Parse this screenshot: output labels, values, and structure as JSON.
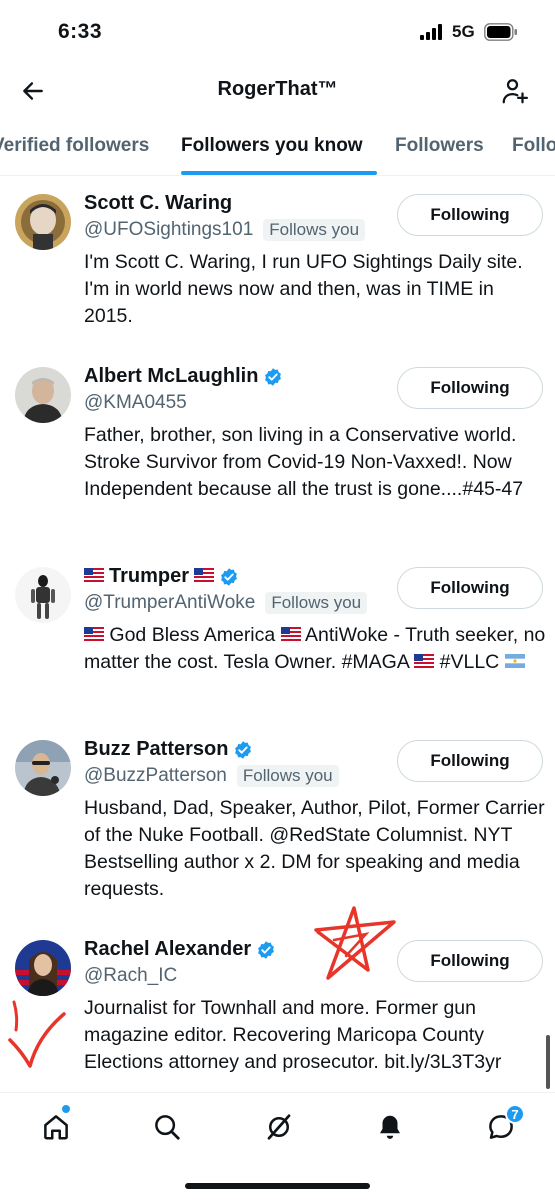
{
  "status_bar": {
    "time": "6:33",
    "network": "5G"
  },
  "header": {
    "title": "RogerThat™"
  },
  "tabs": [
    {
      "label": "Verified followers"
    },
    {
      "label": "Followers you know"
    },
    {
      "label": "Followers"
    },
    {
      "label": "Following"
    }
  ],
  "follows_you_label": "Follows you",
  "users": [
    {
      "name": "Scott C. Waring",
      "handle": "@UFOSightings101",
      "bio": "I'm Scott C. Waring, I run UFO Sightings Daily site. I'm in world news now and then, was in TIME in 2015.",
      "button": "Following"
    },
    {
      "name": "Albert McLaughlin",
      "handle": "@KMA0455",
      "bio": "Father, brother, son living in a Conservative world. Stroke Survivor from Covid-19 Non-Vaxxed!. Now Independent because all the trust is gone....#45-47",
      "button": "Following"
    },
    {
      "name": "Trumper",
      "handle": "@TrumperAntiWoke",
      "bio_part1": "God Bless America",
      "bio_part2": "AntiWoke - Truth seeker, no matter the cost. Tesla Owner. #MAGA",
      "bio_part3": "#VLLC",
      "button": "Following"
    },
    {
      "name": "Buzz Patterson",
      "handle": "@BuzzPatterson",
      "bio": "Husband, Dad, Speaker, Author, Pilot, Former Carrier of the Nuke Football. @RedState Columnist. NYT Bestselling author x 2. DM for speaking and media requests.",
      "button": "Following"
    },
    {
      "name": "Rachel Alexander",
      "handle": "@Rach_IC",
      "bio": "Journalist for Townhall and more. Former gun magazine editor. Recovering Maricopa County Elections attorney and prosecutor. bit.ly/3L3T3yr",
      "button": "Following"
    }
  ],
  "bottom_nav": {
    "messages_badge": "7"
  },
  "colors": {
    "accent": "#1d9bf0",
    "text": "#0f1419",
    "secondary": "#536471",
    "annotation": "#e8352a"
  }
}
